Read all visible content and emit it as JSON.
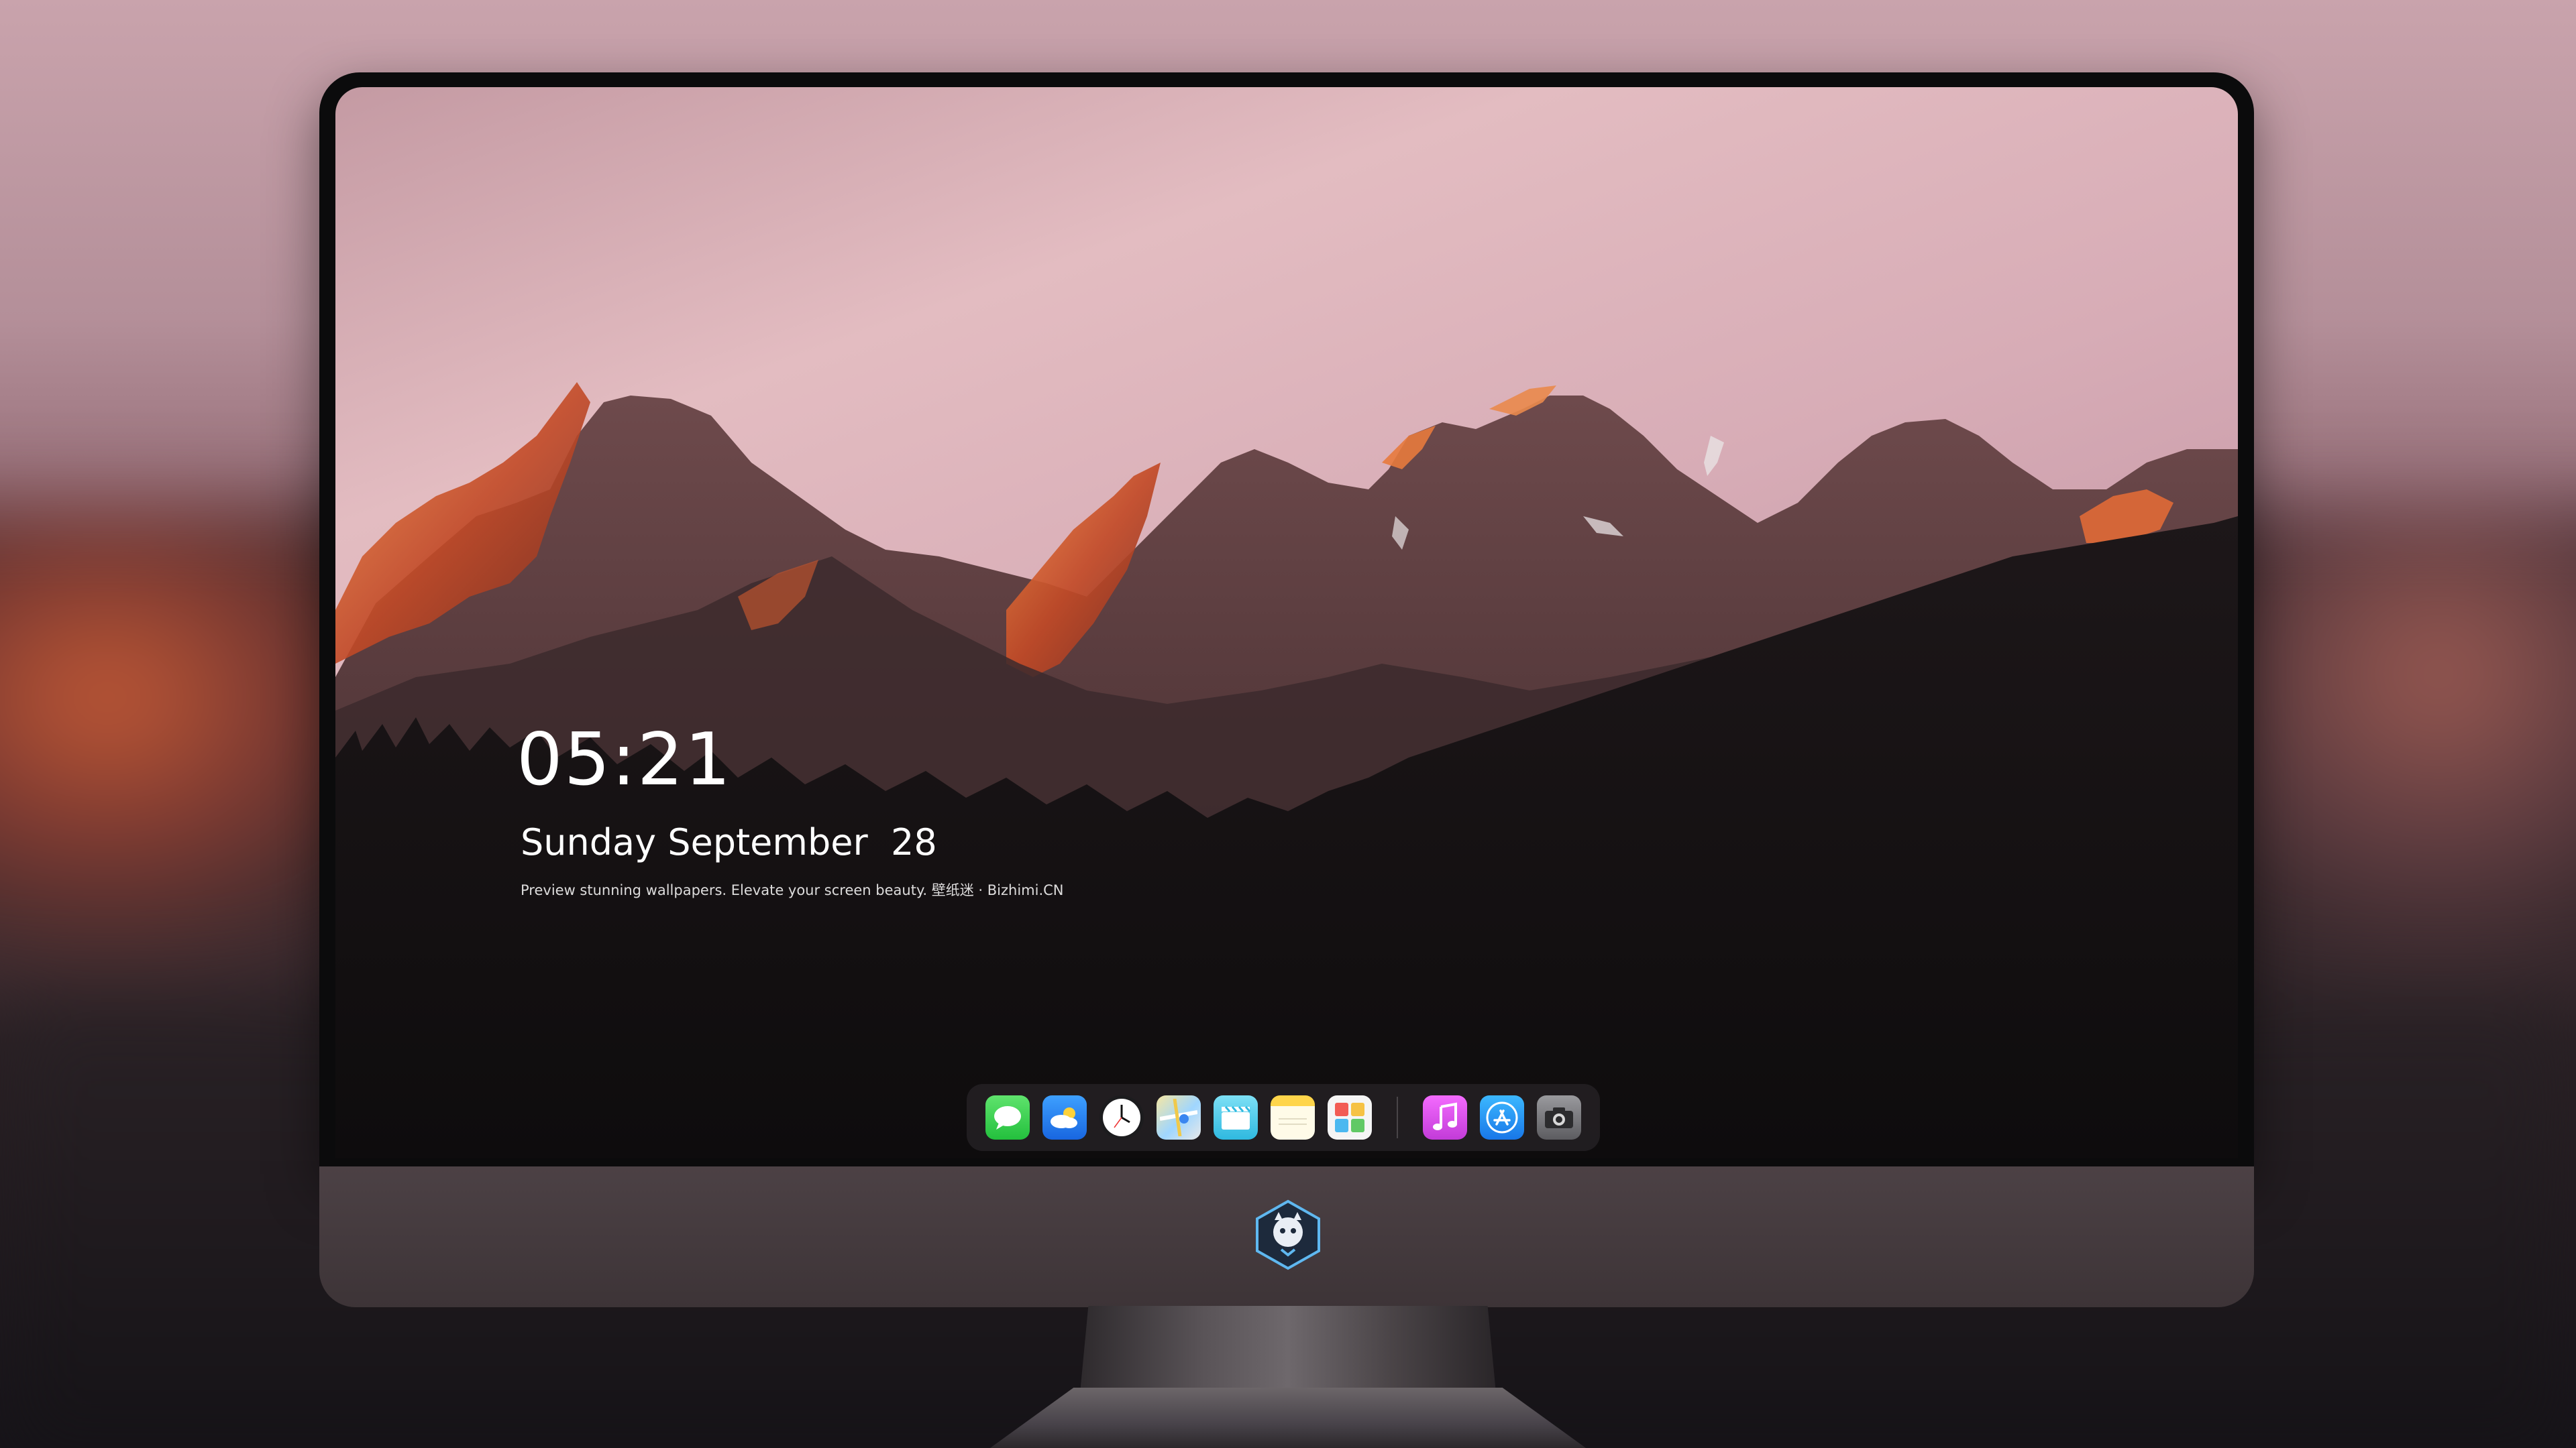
{
  "lockscreen": {
    "time": "05:21",
    "date": "Sunday September  28",
    "tagline": "Preview stunning wallpapers. Elevate your screen beauty. 壁纸迷 · Bizhimi.CN"
  },
  "dock": {
    "apps": [
      {
        "name": "messages",
        "icon": "message-bubble"
      },
      {
        "name": "weather",
        "icon": "cloud-sun"
      },
      {
        "name": "clock",
        "icon": "clock-face"
      },
      {
        "name": "maps",
        "icon": "map"
      },
      {
        "name": "clips",
        "icon": "clapperboard"
      },
      {
        "name": "notes",
        "icon": "notepad"
      },
      {
        "name": "photos",
        "icon": "photo-grid"
      }
    ],
    "apps_right": [
      {
        "name": "music",
        "icon": "music-note"
      },
      {
        "name": "app-store",
        "icon": "app-store-a"
      },
      {
        "name": "camera",
        "icon": "camera"
      }
    ]
  },
  "device": {
    "logo": "mascot-shield-logo"
  },
  "colors": {
    "sky_top": "#e3bcc1",
    "peak_glow": "#d2582c",
    "forest": "#120f10",
    "chin": "#463b3f"
  }
}
